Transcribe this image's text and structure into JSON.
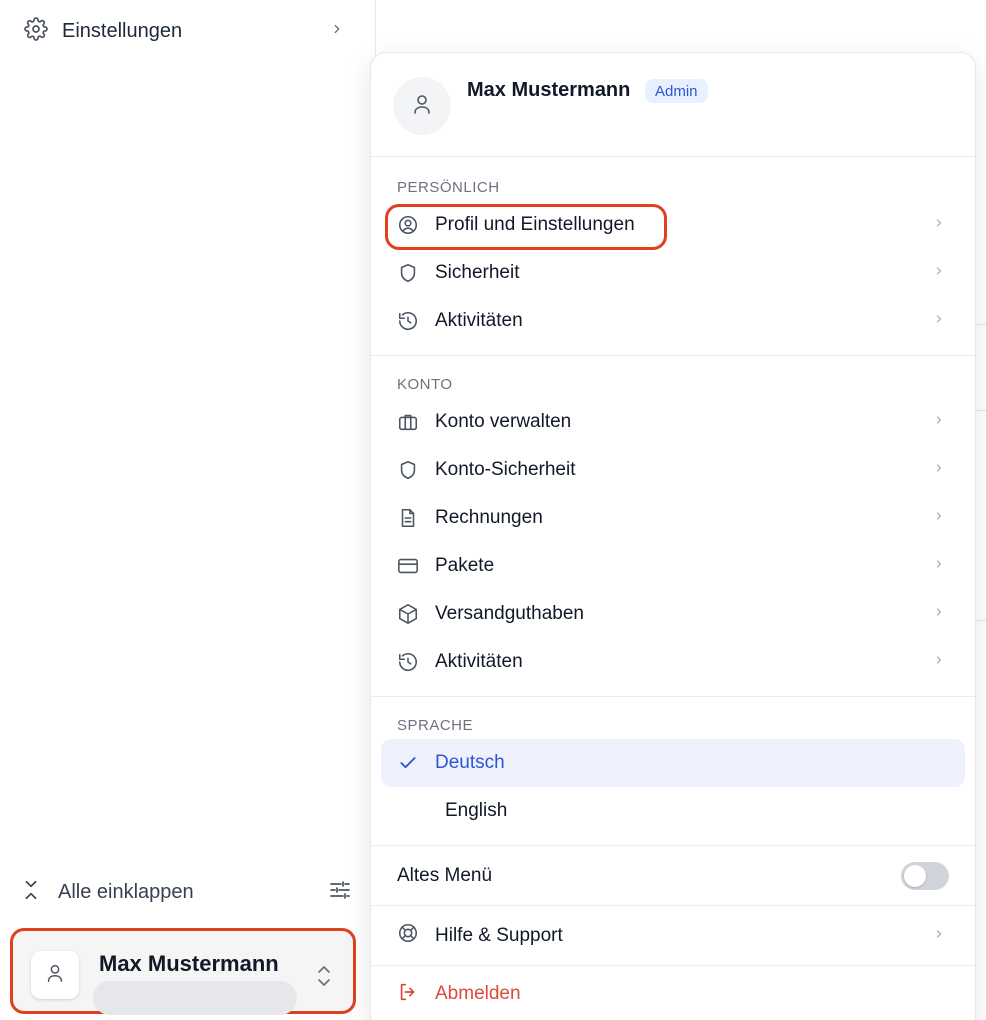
{
  "sidebar": {
    "settings_label": "Einstellungen",
    "collapse_label": "Alle einklappen",
    "user_card_name": "Max Mustermann"
  },
  "menu": {
    "header": {
      "name": "Max Mustermann",
      "badge": "Admin"
    },
    "sections": {
      "personal": {
        "title": "PERSÖNLICH",
        "items": [
          "Profil und Einstellungen",
          "Sicherheit",
          "Aktivitäten"
        ]
      },
      "account": {
        "title": "KONTO",
        "items": [
          "Konto verwalten",
          "Konto-Sicherheit",
          "Rechnungen",
          "Pakete",
          "Versandguthaben",
          "Aktivitäten"
        ]
      },
      "language": {
        "title": "SPRACHE",
        "options": [
          "Deutsch",
          "English"
        ],
        "selected": "Deutsch"
      }
    },
    "old_menu_label": "Altes Menü",
    "old_menu_enabled": false,
    "help_label": "Hilfe & Support",
    "logout_label": "Abmelden"
  },
  "colors": {
    "accent": "#2f54d6",
    "highlight": "#e0401f",
    "logout": "#dc4a3a"
  }
}
